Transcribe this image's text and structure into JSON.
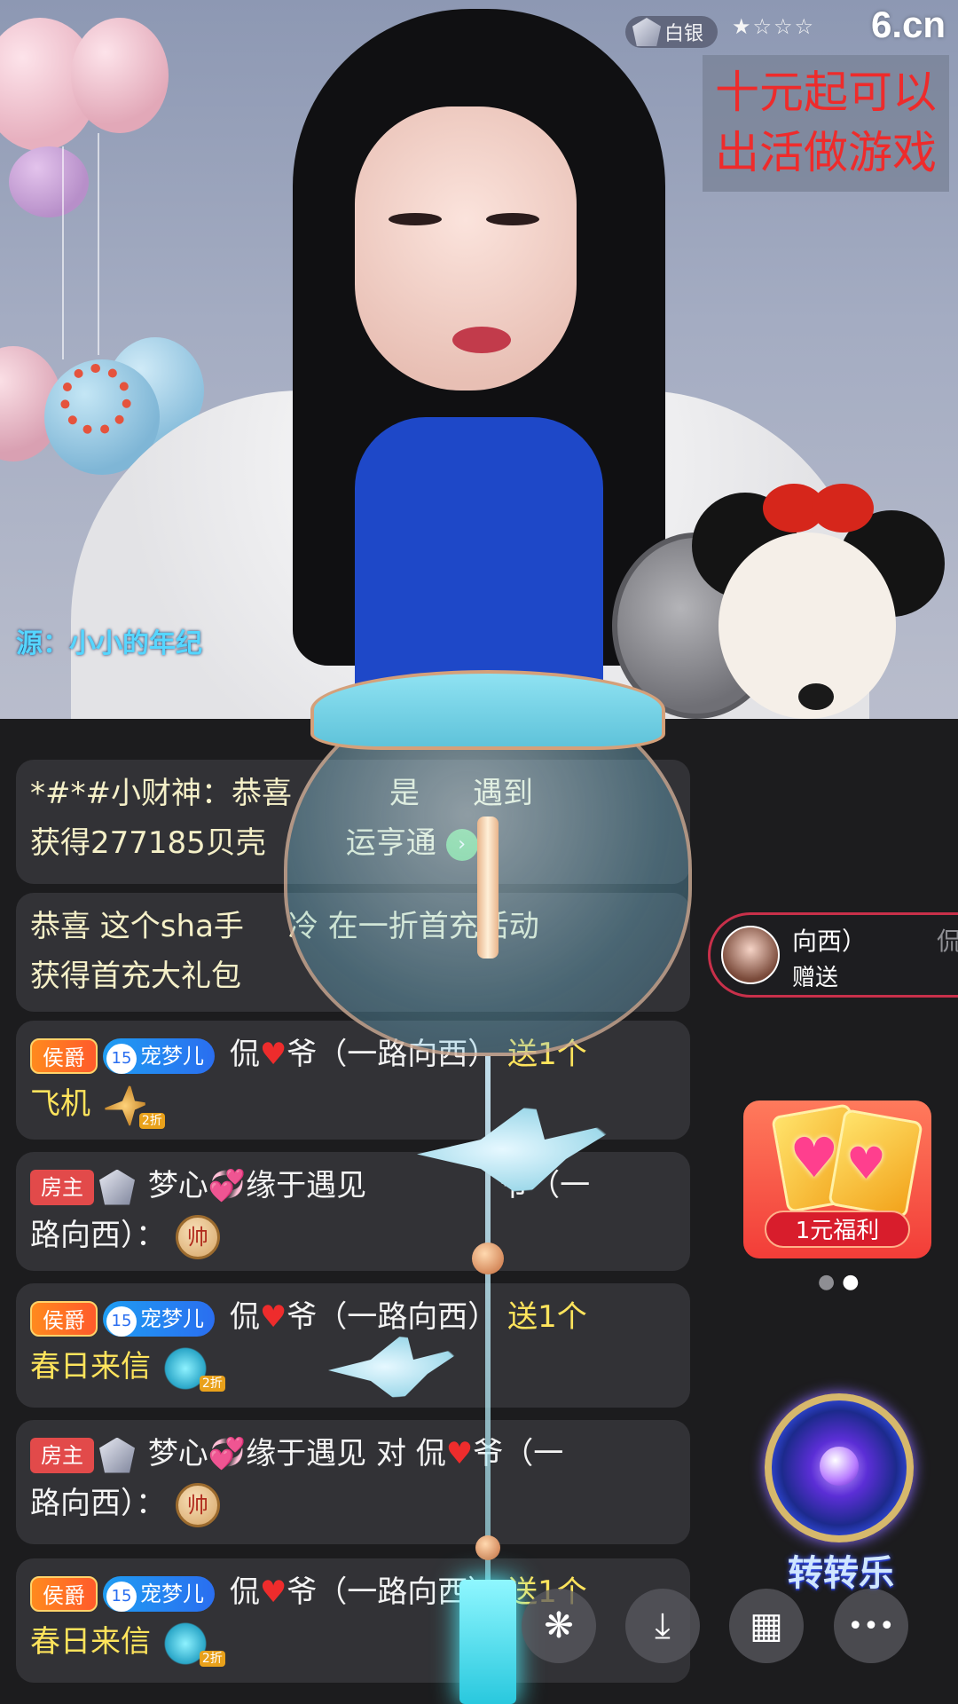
{
  "header": {
    "rank_label": "白银",
    "stars": "★☆☆☆",
    "site_logo": "6.cn"
  },
  "promo": {
    "line1": "十元起可以",
    "line2": "出活做游戏"
  },
  "source": "源：小小的年纪",
  "chat": {
    "msg1": {
      "line1": "*#*#小财神：恭喜",
      "line1b": "是",
      "line1c": "遇到",
      "line2": "获得277185贝壳",
      "line2b": "运亨通"
    },
    "msg2": {
      "line1": "恭喜 这个sha手",
      "line1b": "冷 在一折首充活动",
      "line2": "获得首充大礼包"
    },
    "msg3": {
      "duke": "侯爵",
      "fan_level": "15",
      "fan_name": "宠梦儿",
      "user_a": "侃",
      "user_b": "爷（一路向西）",
      "action": "送1个",
      "gift": "飞机",
      "discount": "2折"
    },
    "msg4": {
      "host": "房主",
      "user": "梦心",
      "user_b": "缘于遇见",
      "to_b": "爷（一",
      "line2": "路向西）：",
      "chess": "帅"
    },
    "msg5": {
      "duke": "侯爵",
      "fan_level": "15",
      "fan_name": "宠梦儿",
      "user_a": "侃",
      "user_b": "爷（一路向西）",
      "action": "送1个",
      "gift": "春日来信",
      "discount": "2折"
    },
    "msg6": {
      "host": "房主",
      "user": "梦心",
      "user_b": "缘于遇见",
      "to": "对",
      "to_a": "侃",
      "to_b": "爷（一",
      "line2": "路向西）：",
      "chess": "帅"
    },
    "msg7": {
      "duke": "侯爵",
      "fan_level": "15",
      "fan_name": "宠梦儿",
      "user_a": "侃",
      "user_b": "爷（一路向西）",
      "action": "送1个",
      "gift": "春日来信",
      "discount": "2折"
    }
  },
  "gift_notice": {
    "name": "向西）",
    "name2": "侃",
    "action": "赠送"
  },
  "welfare": {
    "label": "1元福利"
  },
  "spin": {
    "label": "转转乐"
  },
  "toolbar": {
    "share_icon": "❋",
    "download_icon": "⤓",
    "grid_icon": "▦",
    "more_icon": "•••"
  },
  "colors": {
    "promo_text": "#ee2b2b",
    "gift_text": "#ffe45c",
    "source_text": "#55d6ff"
  }
}
